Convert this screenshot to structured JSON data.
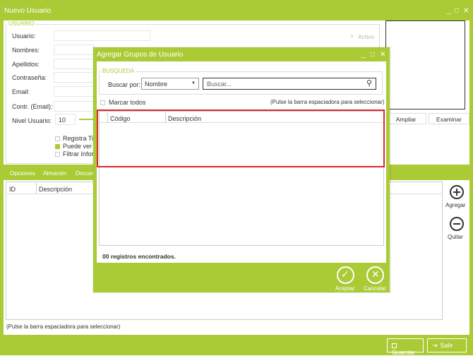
{
  "window": {
    "title": "Nuevo Usuario",
    "controls": [
      "_",
      "□",
      "✕"
    ]
  },
  "usuario_section": {
    "legend": "USUARIO",
    "labels": [
      "Usuario:",
      "Nombres:",
      "Apellidos:",
      "Contraseña:",
      "Email:",
      "Contr. (Email):",
      "Nivel Usuario:"
    ],
    "nivel_value": "10",
    "activo_label": "Activo",
    "checkboxes": [
      {
        "label": "Registra Tip",
        "checked": false
      },
      {
        "label": "Puede ver e",
        "checked": true
      },
      {
        "label": "Filtrar Inforr",
        "checked": false
      }
    ],
    "photo_buttons": [
      "Ampliar",
      "Examinar"
    ]
  },
  "tabs": [
    "Opciones",
    "Almacén",
    "Docum"
  ],
  "grid": {
    "columns": [
      "ID",
      "Descripción"
    ],
    "hint": "(Pulse la barra espaciadora para seleccionar)"
  },
  "side_buttons": {
    "add": "Agregar",
    "remove": "Quitar"
  },
  "footer": {
    "save": "Guardar",
    "exit": "Salir"
  },
  "modal": {
    "title": "Agregar Grupos de Usuario",
    "controls": [
      "_",
      "□",
      "✕"
    ],
    "search": {
      "legend": "BUSQUEDA",
      "buscar_por_label": "Buscar por:",
      "buscar_por_value": "Nombre",
      "placeholder": "Buscar..."
    },
    "select_all": "Marcar todos",
    "hint": "(Pulse la barra espaciadora para seleccionar)",
    "columns": [
      "Código",
      "Descripción"
    ],
    "records": "00 registros encontrados.",
    "accept": "Aceptar",
    "cancel": "Cancelar",
    "highlight_color": "#e0262b"
  },
  "colors": {
    "accent": "#aacb36"
  }
}
